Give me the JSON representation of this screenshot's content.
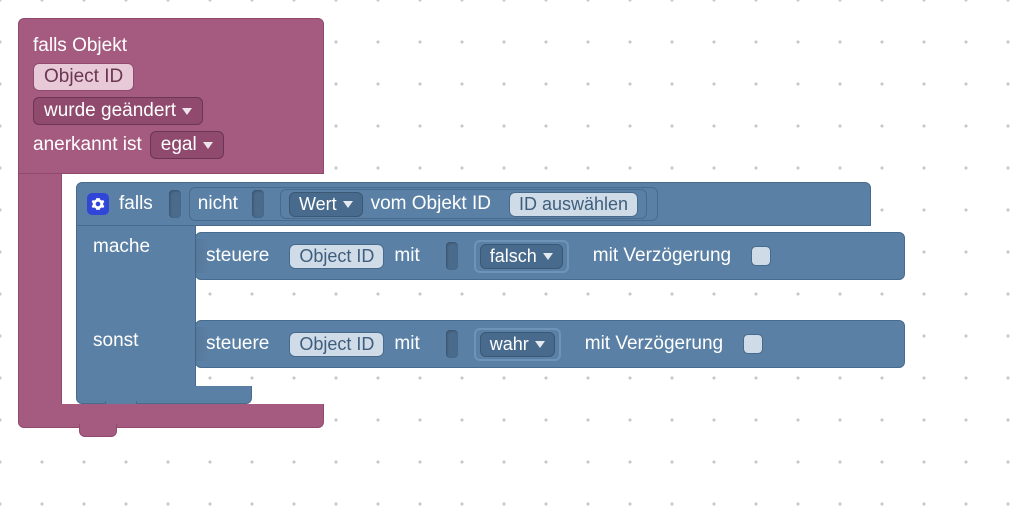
{
  "trigger": {
    "title_prefix": "falls Objekt",
    "object_chip": "Object ID",
    "event_dropdown": "wurde geändert",
    "ack_label": "anerkannt ist",
    "ack_value": "egal"
  },
  "ifelse": {
    "if_label": "falls",
    "not_label": "nicht",
    "value_dropdown": "Wert",
    "from_object_label": "vom Objekt ID",
    "select_id_chip": "ID auswählen",
    "do_label": "mache",
    "else_label": "sonst",
    "control_label": "steuere",
    "object_chip": "Object ID",
    "with_label": "mit",
    "false_value": "falsch",
    "true_value": "wahr",
    "delay_label": "mit Verzögerung"
  }
}
